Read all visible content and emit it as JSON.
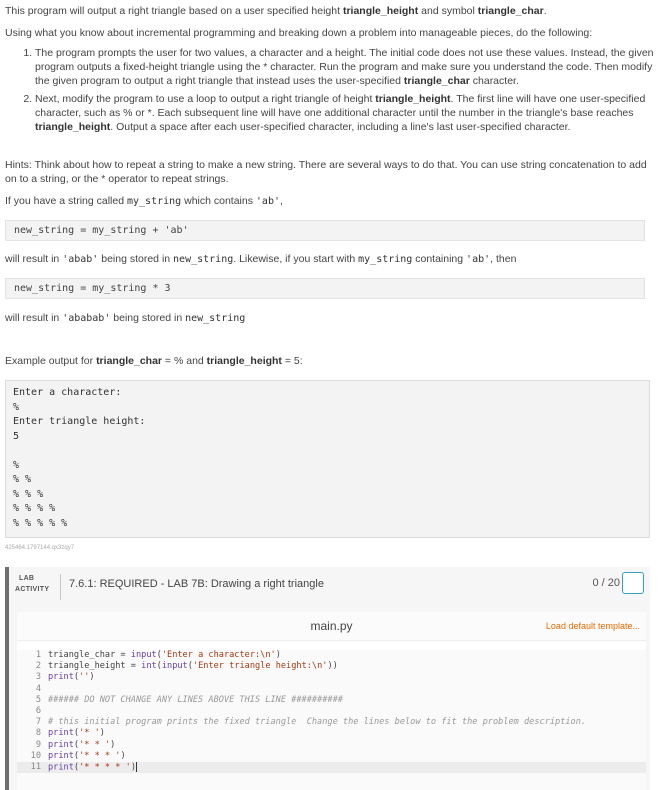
{
  "intro": {
    "line1_pre": "This program will output a right triangle based on a user specified height ",
    "line1_b1": "triangle_height",
    "line1_mid": " and symbol ",
    "line1_b2": "triangle_char",
    "line1_post": ".",
    "line2": "Using what you know about incremental programming and breaking down a problem into manageable pieces, do the following:"
  },
  "steps": [
    {
      "pre": "The program prompts the user for two values, a character and a height. The initial code does not use these values. Instead, the given program outputs a fixed-height triangle using the * character. Run the program and make sure you understand the code. Then modify the given program to output a right triangle that instead uses the user-specified ",
      "b": "triangle_char",
      "post": " character."
    },
    {
      "pre": "Next, modify the program to use a loop to output a right triangle of height ",
      "b1": "triangle_height",
      "mid": ". The first line will have one user-specified character, such as % or *. Each subsequent line will have one additional character until the number in the triangle's base reaches ",
      "b2": "triangle_height",
      "post": ". Output a space after each user-specified character, including a line's last user-specified character."
    }
  ],
  "hints": {
    "text": "Hints: Think about how to repeat a string to make a new string. There are several ways to do that. You can use string concatenation to add on to a string, or the * operator to repeat strings.",
    "have_pre": "If you have a string called ",
    "have_code1": "my_string",
    "have_mid": " which contains ",
    "have_code2": "'ab'",
    "have_post": ",",
    "code1": "new_string = my_string + 'ab'",
    "result1_pre": "will result in ",
    "result1_code": "'abab'",
    "result1_mid": " being stored in ",
    "result1_var": "new_string",
    "result1_mid2": ". Likewise, if you start with ",
    "result1_var2": "my_string",
    "result1_mid3": " containing ",
    "result1_code2": "'ab'",
    "result1_post": ", then",
    "code2": "new_string = my_string * 3",
    "result2_pre": "will result in ",
    "result2_code": "'ababab'",
    "result2_mid": " being stored in ",
    "result2_var": "new_string"
  },
  "example": {
    "label_pre": "Example output for ",
    "label_b1": "triangle_char",
    "label_mid": " = % and ",
    "label_b2": "triangle_height",
    "label_post": " = 5:",
    "output": "Enter a character:\n%\nEnter triangle height:\n5\n\n%\n% %\n% % %\n% % % %\n% % % % %"
  },
  "tiny_id": "425464.1797144.qx3zqy7",
  "lab": {
    "badge_line1": "LAB",
    "badge_line2": "ACTIVITY",
    "title": "7.6.1: REQUIRED - LAB 7B: Drawing a right triangle",
    "score": "0 / 20",
    "file_name": "main.py",
    "load_template": "Load default template..."
  },
  "code_lines": [
    {
      "n": "1",
      "parts": [
        {
          "t": "triangle_char = ",
          "c": ""
        },
        {
          "t": "input",
          "c": "kw-fn"
        },
        {
          "t": "(",
          "c": ""
        },
        {
          "t": "'Enter a character:\\n'",
          "c": "str"
        },
        {
          "t": ")",
          "c": ""
        }
      ]
    },
    {
      "n": "2",
      "parts": [
        {
          "t": "triangle_height = ",
          "c": ""
        },
        {
          "t": "int",
          "c": "kw-fn"
        },
        {
          "t": "(",
          "c": ""
        },
        {
          "t": "input",
          "c": "kw-fn"
        },
        {
          "t": "(",
          "c": ""
        },
        {
          "t": "'Enter triangle height:\\n'",
          "c": "str"
        },
        {
          "t": "))",
          "c": ""
        }
      ]
    },
    {
      "n": "3",
      "parts": [
        {
          "t": "print",
          "c": "kw-fn"
        },
        {
          "t": "(",
          "c": ""
        },
        {
          "t": "''",
          "c": "str"
        },
        {
          "t": ")",
          "c": ""
        }
      ]
    },
    {
      "n": "4",
      "parts": []
    },
    {
      "n": "5",
      "parts": [
        {
          "t": "###### DO NOT CHANGE ANY LINES ABOVE THIS LINE ##########",
          "c": "com"
        }
      ]
    },
    {
      "n": "6",
      "parts": []
    },
    {
      "n": "7",
      "parts": [
        {
          "t": "# this initial program prints the fixed triangle  Change the lines below to fit the problem description.",
          "c": "com"
        }
      ]
    },
    {
      "n": "8",
      "parts": [
        {
          "t": "print",
          "c": "kw-fn"
        },
        {
          "t": "(",
          "c": ""
        },
        {
          "t": "'* '",
          "c": "str"
        },
        {
          "t": ")",
          "c": ""
        }
      ]
    },
    {
      "n": "9",
      "parts": [
        {
          "t": "print",
          "c": "kw-fn"
        },
        {
          "t": "(",
          "c": ""
        },
        {
          "t": "'* * '",
          "c": "str"
        },
        {
          "t": ")",
          "c": ""
        }
      ]
    },
    {
      "n": "10",
      "parts": [
        {
          "t": "print",
          "c": "kw-fn"
        },
        {
          "t": "(",
          "c": ""
        },
        {
          "t": "'* * * '",
          "c": "str"
        },
        {
          "t": ")",
          "c": ""
        }
      ]
    },
    {
      "n": "11",
      "parts": [
        {
          "t": "print",
          "c": "kw-fn"
        },
        {
          "t": "(",
          "c": ""
        },
        {
          "t": "'* * * * '",
          "c": "str"
        },
        {
          "t": ")",
          "c": ""
        }
      ]
    }
  ]
}
